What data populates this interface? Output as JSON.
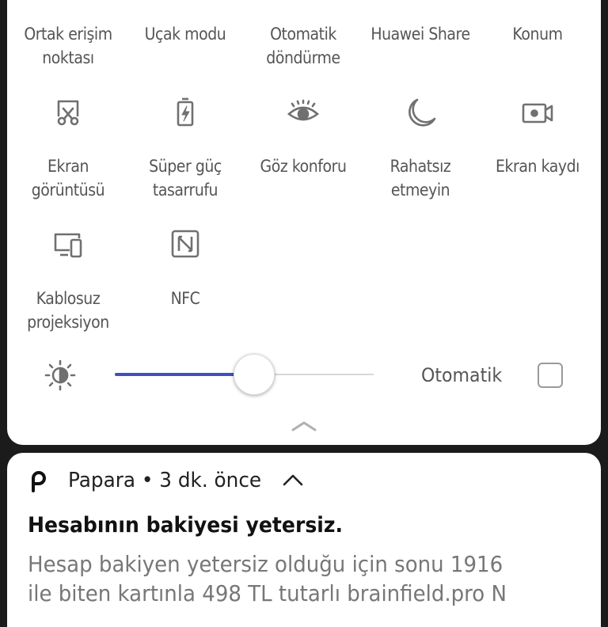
{
  "quick_settings": {
    "top_row": [
      {
        "label": "Ortak erişim\nnoktası"
      },
      {
        "label": "Uçak modu"
      },
      {
        "label": "Otomatik\ndöndürme"
      },
      {
        "label": "Huawei Share"
      },
      {
        "label": "Konum"
      }
    ],
    "row2": [
      {
        "label": "Ekran\ngörüntüsü",
        "icon": "screenshot-icon"
      },
      {
        "label": "Süper güç\ntasarrufu",
        "icon": "battery-saver-icon"
      },
      {
        "label": "Göz konforu",
        "icon": "eye-icon"
      },
      {
        "label": "Rahatsız\netmeyin",
        "icon": "moon-icon"
      },
      {
        "label": "Ekran kaydı",
        "icon": "screen-record-icon"
      }
    ],
    "row3": [
      {
        "label": "Kablosuz\nprojeksiyon",
        "icon": "wireless-projection-icon"
      },
      {
        "label": "NFC",
        "icon": "nfc-icon"
      }
    ],
    "brightness": {
      "level": 0.54,
      "auto_label": "Otomatik",
      "auto_checked": false
    }
  },
  "notification": {
    "app_icon_letter": "ρ",
    "app_line": "Papara • 3 dk. önce",
    "title": "Hesabının bakiyesi yetersiz.",
    "body": "Hesap bakiyen yetersiz olduğu için sonu 1916\nile biten kartınla 498 TL tutarlı brainfield.pro N"
  },
  "colors": {
    "accent": "#3f4fbf",
    "icon": "#707070",
    "label": "#555555"
  }
}
